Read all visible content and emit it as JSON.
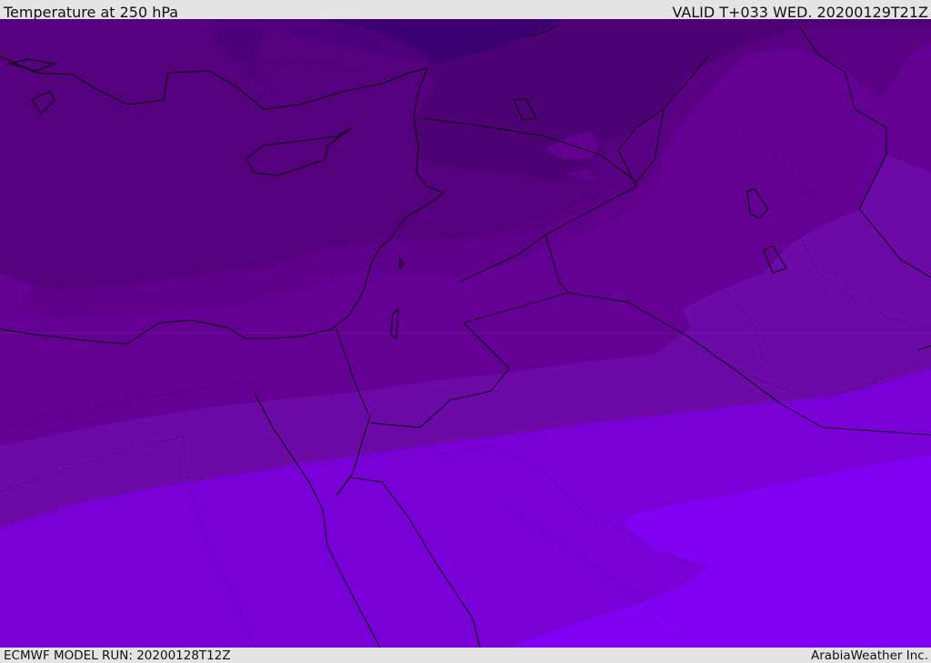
{
  "header": {
    "title": "Temperature at 250 hPa",
    "valid_time": "VALID T+033 WED. 20200129T21Z"
  },
  "footer": {
    "model_run": "ECMWF MODEL RUN: 20200128T12Z",
    "credit": "ArabiaWeather Inc."
  },
  "map": {
    "field": "temperature_250hPa",
    "color_bands": [
      "#3d0070",
      "#4e0075",
      "#5a0080",
      "#650092",
      "#6c0aa8",
      "#7a00d8",
      "#8200f4"
    ],
    "coastline_color": "#000000",
    "border_style": "dotted"
  }
}
